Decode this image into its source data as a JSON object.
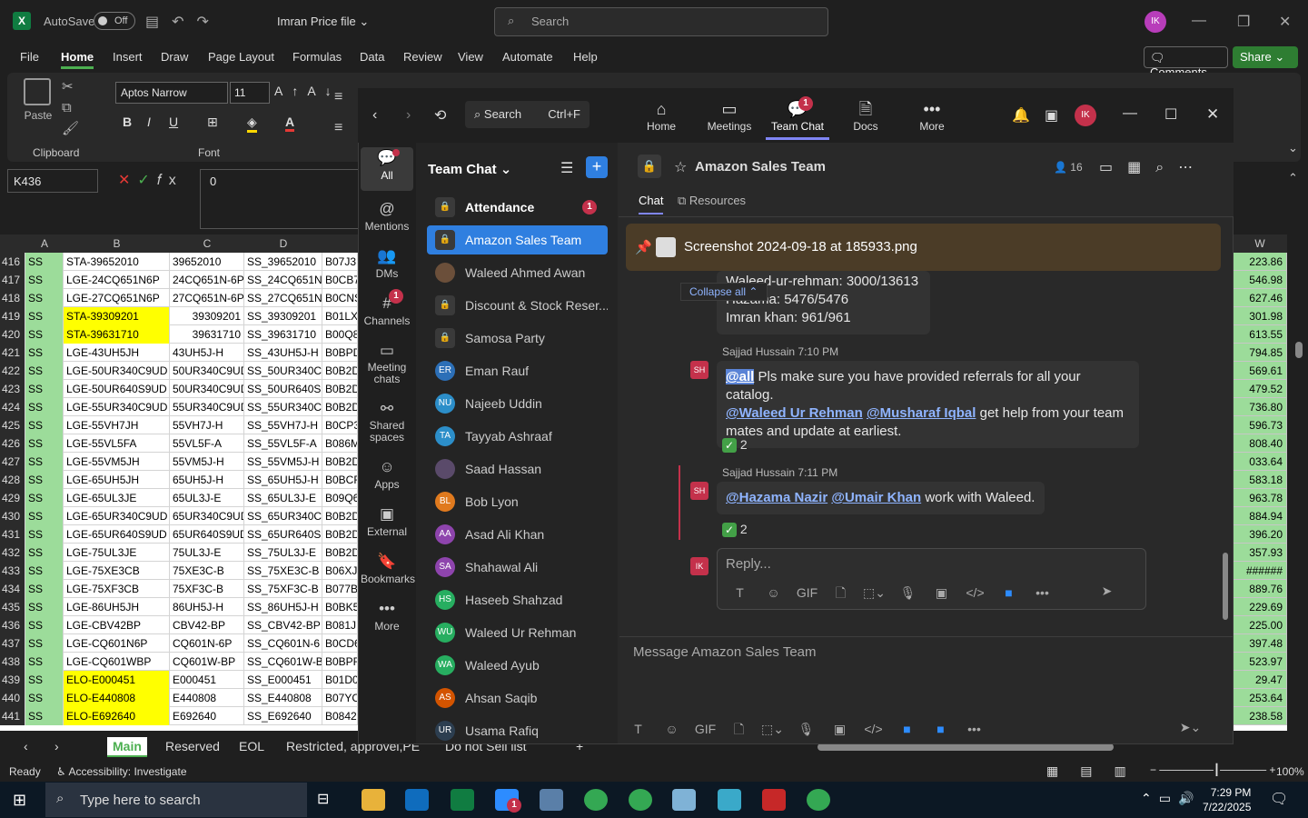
{
  "excel": {
    "autosave_label": "AutoSave",
    "autosave_state": "Off",
    "file_name": "Imran Price file",
    "search_placeholder": "Search",
    "user_initials": "IK",
    "menu": [
      "File",
      "Home",
      "Insert",
      "Draw",
      "Page Layout",
      "Formulas",
      "Data",
      "Review",
      "View",
      "Automate",
      "Help"
    ],
    "comments_label": "Comments",
    "share_label": "Share",
    "paste_label": "Paste",
    "clipboard_label": "Clipboard",
    "font_label": "Font",
    "font_name": "Aptos Narrow",
    "font_size": "11",
    "insert_label": "Insert",
    "name_box": "K436",
    "formula_value": "0",
    "columns": [
      "A",
      "B",
      "C",
      "D"
    ],
    "right_column": "W",
    "rows": [
      {
        "n": "416",
        "a": "SS",
        "b": "STA-39652010",
        "c": "39652010",
        "d": "SS_39652010",
        "e": "B07J3",
        "bhl": false,
        "cnum": false
      },
      {
        "n": "417",
        "a": "SS",
        "b": "LGE-24CQ651N6P",
        "c": "24CQ651N-6P",
        "d": "SS_24CQ651N",
        "e": "B0CB7",
        "bhl": false,
        "cnum": false
      },
      {
        "n": "418",
        "a": "SS",
        "b": "LGE-27CQ651N6P",
        "c": "27CQ651N-6P",
        "d": "SS_27CQ651N",
        "e": "B0CNS",
        "bhl": false,
        "cnum": false
      },
      {
        "n": "419",
        "a": "SS",
        "b": "STA-39309201",
        "c": "39309201",
        "d": "SS_39309201",
        "e": "B01LX",
        "bhl": true,
        "cnum": true
      },
      {
        "n": "420",
        "a": "SS",
        "b": "STA-39631710",
        "c": "39631710",
        "d": "SS_39631710",
        "e": "B00Q8",
        "bhl": true,
        "cnum": true
      },
      {
        "n": "421",
        "a": "SS",
        "b": "LGE-43UH5JH",
        "c": "43UH5J-H",
        "d": "SS_43UH5J-H",
        "e": "B0BPD",
        "bhl": false,
        "cnum": false
      },
      {
        "n": "422",
        "a": "SS",
        "b": "LGE-50UR340C9UD",
        "c": "50UR340C9UD",
        "d": "SS_50UR340C9",
        "e": "B0B2D",
        "bhl": false,
        "cnum": false
      },
      {
        "n": "423",
        "a": "SS",
        "b": "LGE-50UR640S9UD",
        "c": "50UR340C9UD",
        "d": "SS_50UR640S9",
        "e": "B0B2D",
        "bhl": false,
        "cnum": false
      },
      {
        "n": "424",
        "a": "SS",
        "b": "LGE-55UR340C9UD",
        "c": "55UR340C9UD",
        "d": "SS_55UR340C9",
        "e": "B0B2D",
        "bhl": false,
        "cnum": false
      },
      {
        "n": "425",
        "a": "SS",
        "b": "LGE-55VH7JH",
        "c": "55VH7J-H",
        "d": "SS_55VH7J-H",
        "e": "B0CP3",
        "bhl": false,
        "cnum": false
      },
      {
        "n": "426",
        "a": "SS",
        "b": "LGE-55VL5FA",
        "c": "55VL5F-A",
        "d": "SS_55VL5F-A",
        "e": "B086M",
        "bhl": false,
        "cnum": false
      },
      {
        "n": "427",
        "a": "SS",
        "b": "LGE-55VM5JH",
        "c": "55VM5J-H",
        "d": "SS_55VM5J-H",
        "e": "B0B2D",
        "bhl": false,
        "cnum": false
      },
      {
        "n": "428",
        "a": "SS",
        "b": "LGE-65UH5JH",
        "c": "65UH5J-H",
        "d": "SS_65UH5J-H",
        "e": "B0BCF",
        "bhl": false,
        "cnum": false
      },
      {
        "n": "429",
        "a": "SS",
        "b": "LGE-65UL3JE",
        "c": "65UL3J-E",
        "d": "SS_65UL3J-E",
        "e": "B09Q6",
        "bhl": false,
        "cnum": false
      },
      {
        "n": "430",
        "a": "SS",
        "b": "LGE-65UR340C9UD",
        "c": "65UR340C9UD",
        "d": "SS_65UR340C9",
        "e": "B0B2D",
        "bhl": false,
        "cnum": false
      },
      {
        "n": "431",
        "a": "SS",
        "b": "LGE-65UR640S9UD",
        "c": "65UR640S9UD",
        "d": "SS_65UR640S9",
        "e": "B0B2D",
        "bhl": false,
        "cnum": false
      },
      {
        "n": "432",
        "a": "SS",
        "b": "LGE-75UL3JE",
        "c": "75UL3J-E",
        "d": "SS_75UL3J-E",
        "e": "B0B2D",
        "bhl": false,
        "cnum": false
      },
      {
        "n": "433",
        "a": "SS",
        "b": "LGE-75XE3CB",
        "c": "75XE3C-B",
        "d": "SS_75XE3C-B",
        "e": "B06XJ",
        "bhl": false,
        "cnum": false
      },
      {
        "n": "434",
        "a": "SS",
        "b": "LGE-75XF3CB",
        "c": "75XF3C-B",
        "d": "SS_75XF3C-B",
        "e": "B077B",
        "bhl": false,
        "cnum": false
      },
      {
        "n": "435",
        "a": "SS",
        "b": "LGE-86UH5JH",
        "c": "86UH5J-H",
        "d": "SS_86UH5J-H",
        "e": "B0BK5",
        "bhl": false,
        "cnum": false
      },
      {
        "n": "436",
        "a": "SS",
        "b": "LGE-CBV42BP",
        "c": "CBV42-BP",
        "d": "SS_CBV42-BP",
        "e": "B081J",
        "bhl": false,
        "cnum": false
      },
      {
        "n": "437",
        "a": "SS",
        "b": "LGE-CQ601N6P",
        "c": "CQ601N-6P",
        "d": "SS_CQ601N-6",
        "e": "B0CD6",
        "bhl": false,
        "cnum": false
      },
      {
        "n": "438",
        "a": "SS",
        "b": "LGE-CQ601WBP",
        "c": "CQ601W-BP",
        "d": "SS_CQ601W-B",
        "e": "B0BPF",
        "bhl": false,
        "cnum": false
      },
      {
        "n": "439",
        "a": "SS",
        "b": "ELO-E000451",
        "c": "E000451",
        "d": "SS_E000451",
        "e": "B01D0",
        "bhl": true,
        "cnum": false
      },
      {
        "n": "440",
        "a": "SS",
        "b": "ELO-E440808",
        "c": "E440808",
        "d": "SS_E440808",
        "e": "B07YC",
        "bhl": true,
        "cnum": false
      },
      {
        "n": "441",
        "a": "SS",
        "b": "ELO-E692640",
        "c": "E692640",
        "d": "SS_E692640",
        "e": "B0842",
        "bhl": true,
        "cnum": false
      }
    ],
    "right_values": [
      "223.86",
      "546.98",
      "627.46",
      "301.98",
      "613.55",
      "794.85",
      "569.61",
      "479.52",
      "736.80",
      "596.73",
      "808.40",
      "033.64",
      "583.18",
      "963.78",
      "884.94",
      "396.20",
      "357.93",
      "######",
      "889.76",
      "229.69",
      "225.00",
      "397.48",
      "523.97",
      "29.47",
      "253.64",
      "238.58"
    ],
    "sheet_tabs": [
      "Main",
      "Reserved",
      "EOL",
      "Restricted, approvel,PE",
      "Do not Sell list"
    ],
    "status_ready": "Ready",
    "status_accessibility": "Accessibility: Investigate",
    "zoom": "100%"
  },
  "teams": {
    "search_label": "Search",
    "search_shortcut": "Ctrl+F",
    "nav": [
      {
        "label": "Home",
        "icon": "home-icon",
        "glyph": "⌂",
        "badge": ""
      },
      {
        "label": "Meetings",
        "icon": "video-icon",
        "glyph": "▭",
        "badge": ""
      },
      {
        "label": "Team Chat",
        "icon": "chat-icon",
        "glyph": "💬",
        "badge": "1"
      },
      {
        "label": "Docs",
        "icon": "doc-icon",
        "glyph": "🗎",
        "badge": ""
      },
      {
        "label": "More",
        "icon": "more-icon",
        "glyph": "•••",
        "badge": ""
      }
    ],
    "user_initials": "IK",
    "rail": [
      {
        "label": "All",
        "glyph": "💬"
      },
      {
        "label": "Mentions",
        "glyph": "@"
      },
      {
        "label": "DMs",
        "glyph": "👥"
      },
      {
        "label": "Channels",
        "glyph": "#"
      },
      {
        "label": "Meeting chats",
        "glyph": "▭"
      },
      {
        "label": "Shared spaces",
        "glyph": "⚯"
      },
      {
        "label": "Apps",
        "glyph": "☺"
      },
      {
        "label": "External",
        "glyph": "▣"
      },
      {
        "label": "Bookmarks",
        "glyph": "🔖"
      },
      {
        "label": "More",
        "glyph": "•••"
      }
    ],
    "channels_badge": "1",
    "list_title": "Team Chat",
    "chats": [
      {
        "name": "Attendance",
        "initials": "",
        "color": "#3a3a3a",
        "lock": true,
        "badge": "1"
      },
      {
        "name": "Amazon Sales Team",
        "initials": "",
        "color": "#3a3a3a",
        "lock": true,
        "badge": ""
      },
      {
        "name": "Waleed Ahmed Awan",
        "initials": "",
        "color": "#6b4f3a",
        "lock": false,
        "badge": ""
      },
      {
        "name": "Discount & Stock Reser...",
        "initials": "",
        "color": "#3a3a3a",
        "lock": true,
        "badge": ""
      },
      {
        "name": "Samosa Party",
        "initials": "",
        "color": "#3a3a3a",
        "lock": true,
        "badge": ""
      },
      {
        "name": "Eman Rauf",
        "initials": "ER",
        "color": "#2c6fb7",
        "lock": false,
        "badge": ""
      },
      {
        "name": "Najeeb Uddin",
        "initials": "NU",
        "color": "#2c8ec9",
        "lock": false,
        "badge": ""
      },
      {
        "name": "Tayyab Ashraaf",
        "initials": "TA",
        "color": "#2c8ec9",
        "lock": false,
        "badge": ""
      },
      {
        "name": "Saad Hassan",
        "initials": "",
        "color": "#5a4a6a",
        "lock": false,
        "badge": ""
      },
      {
        "name": "Bob Lyon",
        "initials": "BL",
        "color": "#e07a1e",
        "lock": false,
        "badge": ""
      },
      {
        "name": "Asad Ali Khan",
        "initials": "AA",
        "color": "#8e44ad",
        "lock": false,
        "badge": ""
      },
      {
        "name": "Shahawal Ali",
        "initials": "SA",
        "color": "#8e44ad",
        "lock": false,
        "badge": ""
      },
      {
        "name": "Haseeb Shahzad",
        "initials": "HS",
        "color": "#27ae60",
        "lock": false,
        "badge": ""
      },
      {
        "name": "Waleed Ur Rehman",
        "initials": "WU",
        "color": "#27ae60",
        "lock": false,
        "badge": ""
      },
      {
        "name": "Waleed Ayub",
        "initials": "WA",
        "color": "#27ae60",
        "lock": false,
        "badge": ""
      },
      {
        "name": "Ahsan Saqib",
        "initials": "AS",
        "color": "#d35400",
        "lock": false,
        "badge": ""
      },
      {
        "name": "Usama Rafiq",
        "initials": "UR",
        "color": "#2c3e50",
        "lock": false,
        "badge": ""
      }
    ],
    "channel_name": "Amazon Sales Team",
    "member_count": "16",
    "tabs": [
      "Chat",
      "Resources"
    ],
    "pinned_file": "Screenshot 2024-09-18 at 185933.png",
    "collapse_label": "Collapse all",
    "prev_lines": [
      "Waleed-ur-rehman: 3000/13613",
      "Hazama: 5476/5476",
      "Imran khan: 961/961"
    ],
    "messages": [
      {
        "initials": "SH",
        "sender": "Sajjad Hussain",
        "time": "7:10 PM",
        "mention_all": "@all",
        "text1": " Pls make sure you have provided referrals for all your catalog.",
        "mention_a": "@Waleed Ur Rehman",
        "mention_b": "@Musharaf Iqbal",
        "text2": " get help from your team mates and update at earliest.",
        "reaction_count": "2"
      },
      {
        "initials": "SH",
        "sender": "Sajjad Hussain",
        "time": "7:11 PM",
        "mention_a": "@Hazama Nazir",
        "mention_b": "@Umair Khan",
        "text": " work with Waleed.",
        "reaction_count": "2"
      }
    ],
    "reply_placeholder": "Reply...",
    "message_placeholder": "Message Amazon Sales Team"
  },
  "taskbar": {
    "search_placeholder": "Type here to search",
    "time": "7:29 PM",
    "date": "7/22/2025",
    "zoom_badge": "1"
  }
}
